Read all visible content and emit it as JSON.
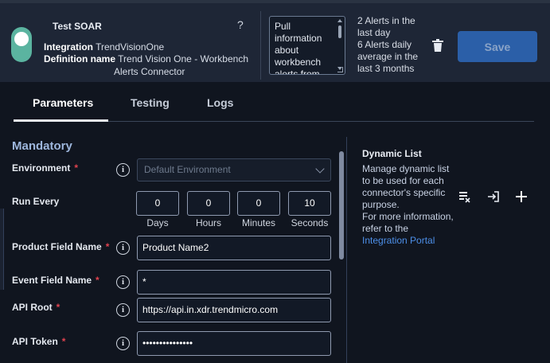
{
  "header": {
    "title": "Test SOAR",
    "help": "?",
    "integration_label": "Integration",
    "integration_value": "TrendVisionOne",
    "definition_label": "Definition name",
    "definition_value": "Trend Vision One - Workbench",
    "definition_value_cont": "Alerts Connector",
    "description_lines": [
      "Pull",
      "information",
      "about",
      "workbench",
      "alerts from"
    ],
    "alerts_stats": [
      "2 Alerts in the",
      "last day",
      "6 Alerts daily",
      "average in the",
      "last 3 months"
    ],
    "save_label": "Save",
    "toggle_state": "on"
  },
  "tabs": [
    {
      "label": "Parameters",
      "active": true
    },
    {
      "label": "Testing",
      "active": false
    },
    {
      "label": "Logs",
      "active": false
    }
  ],
  "form": {
    "section_title": "Mandatory",
    "environment": {
      "label": "Environment",
      "required": "*",
      "placeholder": "Default Environment"
    },
    "run_every": {
      "label": "Run Every",
      "fields": [
        {
          "value": "0",
          "unit": "Days"
        },
        {
          "value": "0",
          "unit": "Hours"
        },
        {
          "value": "0",
          "unit": "Minutes"
        },
        {
          "value": "10",
          "unit": "Seconds"
        }
      ]
    },
    "product_field": {
      "label": "Product Field Name",
      "required": "*",
      "value": "Product Name2"
    },
    "event_field": {
      "label": "Event Field Name",
      "required": "*",
      "value": "*"
    },
    "api_root": {
      "label": "API Root",
      "required": "*",
      "value": "https://api.in.xdr.trendmicro.com"
    },
    "api_token": {
      "label": "API Token",
      "required": "*",
      "value": "•••••••••••••••"
    },
    "info_glyph": "i"
  },
  "dynamic_list": {
    "title": "Dynamic List",
    "description_lines": [
      "Manage dynamic list",
      "to be used for each",
      "connector's specific",
      "purpose.",
      "For more information,",
      "refer to the"
    ],
    "link_text": "Integration Portal",
    "icons": [
      "clear-list-icon",
      "import-icon",
      "add-icon"
    ]
  },
  "colors": {
    "accent": "#2b5fa8",
    "link": "#4d8fe8",
    "required": "#e0434f",
    "section": "#9eb7dd",
    "toggle": "#5bb4a0"
  }
}
